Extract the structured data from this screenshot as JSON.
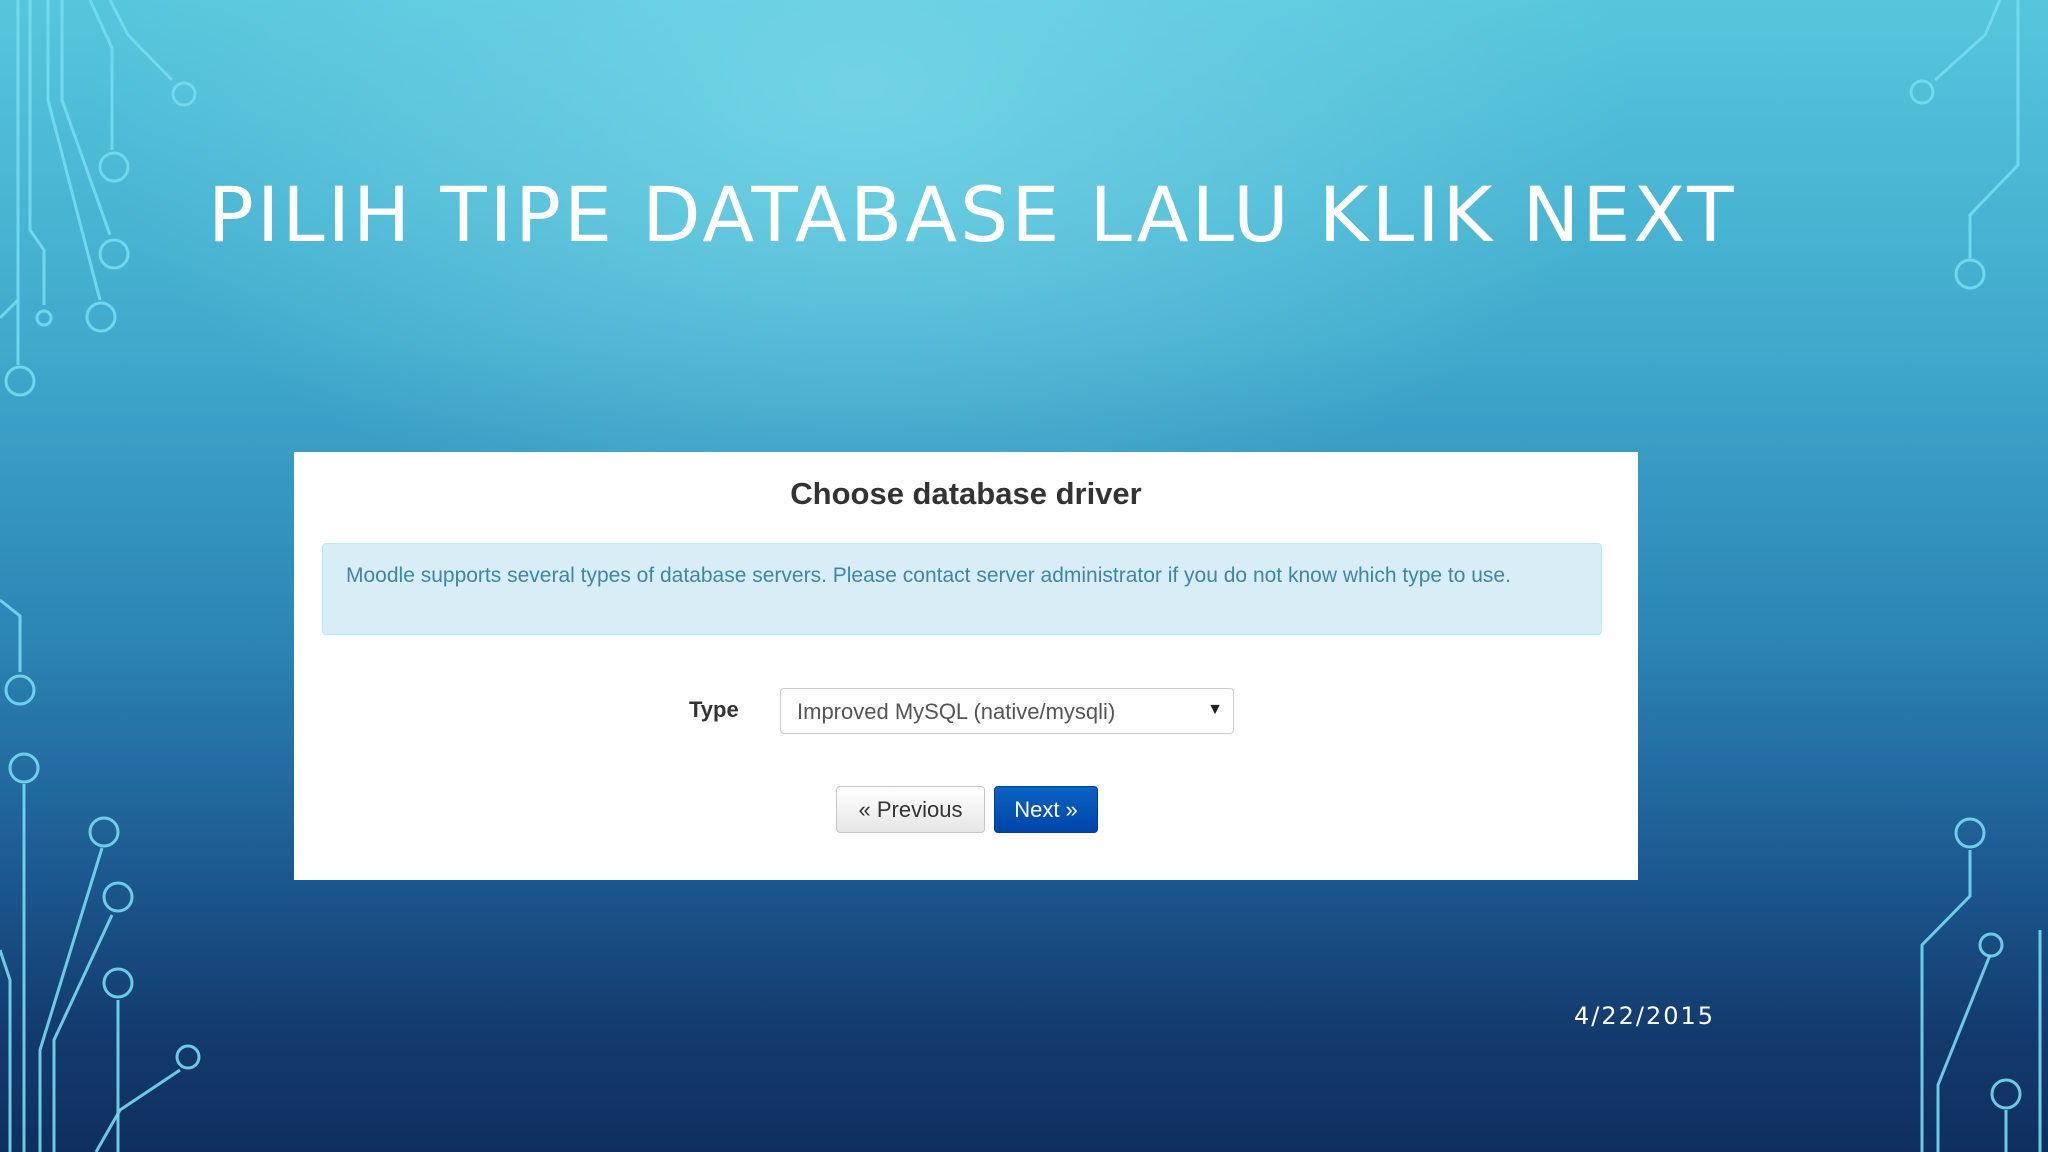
{
  "slide": {
    "title": "PILIH TIPE DATABASE LALU KLIK NEXT",
    "date": "4/22/2015"
  },
  "installer": {
    "heading": "Choose database driver",
    "info_text": "Moodle supports several types of database servers. Please contact server administrator if you do not know which type to use.",
    "type_label": "Type",
    "type_value": "Improved MySQL (native/mysqli)",
    "dropdown_arrow": "▼",
    "previous_label": "« Previous",
    "next_label": "Next »"
  },
  "colors": {
    "info_background": "#d9edf7",
    "info_text": "#3a87ad",
    "next_button": "#0055b3",
    "circuit_lines": "#74dcf0"
  },
  "icons": {
    "decoration": "circuit-board-lines",
    "dropdown": "caret-down-icon"
  }
}
